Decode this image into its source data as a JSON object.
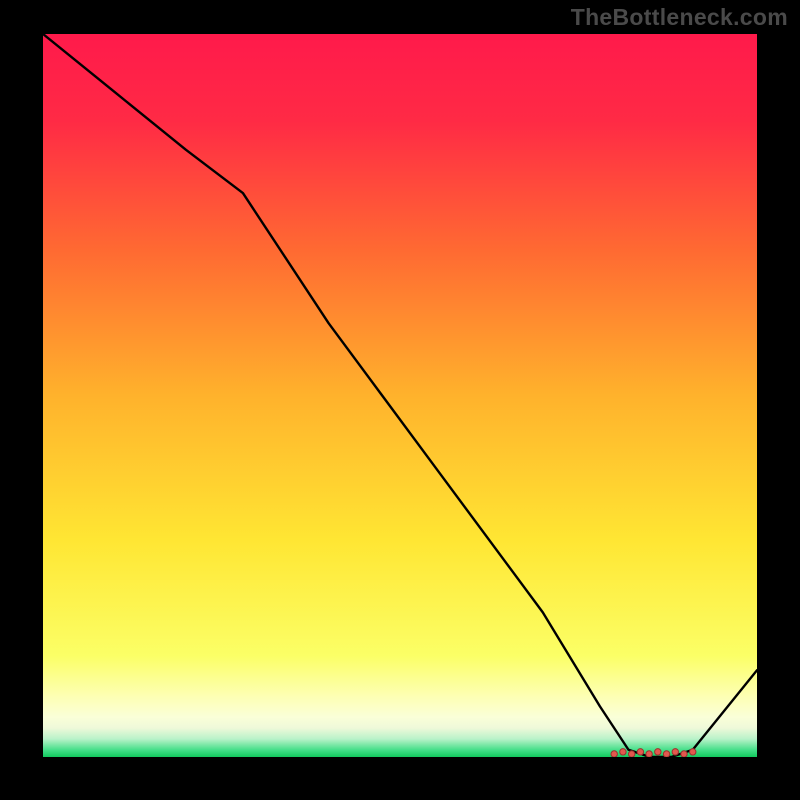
{
  "watermark": "TheBottleneck.com",
  "colors": {
    "top": "#ff1a4b",
    "mid": "#ffe633",
    "pale": "#fbffb5",
    "bottom_band_light": "#e6ffe6",
    "bottom_band_green": "#1fd66b",
    "line": "#000000",
    "marker_fill": "#e2584e",
    "marker_stroke": "#9c322e"
  },
  "chart_data": {
    "type": "line",
    "title": "",
    "xlabel": "",
    "ylabel": "",
    "xlim": [
      0,
      100
    ],
    "ylim": [
      0,
      100
    ],
    "x": [
      0,
      10,
      20,
      28,
      40,
      55,
      70,
      78,
      82,
      85,
      88,
      91,
      100
    ],
    "values": [
      100,
      92,
      84,
      78,
      60,
      40,
      20,
      7,
      1,
      0,
      0,
      1,
      12
    ],
    "markers": {
      "x_start": 80,
      "x_end": 91,
      "y": 0,
      "approx_count": 10
    }
  }
}
